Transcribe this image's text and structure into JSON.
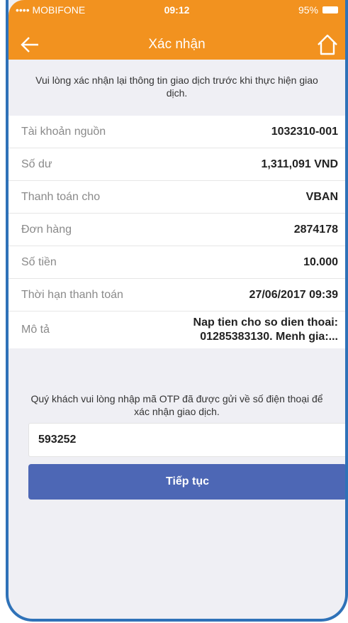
{
  "status_bar": {
    "carrier": "•••• MOBIFONE",
    "time": "09:12",
    "battery": "95%"
  },
  "header": {
    "title": "Xác nhận"
  },
  "intro_text": "Vui lòng xác nhận lại thông tin giao dịch trước khi thực hiện giao dịch.",
  "details": [
    {
      "label": "Tài khoản nguồn",
      "value": "1032310-001"
    },
    {
      "label": "Số dư",
      "value": "1,311,091 VND"
    },
    {
      "label": "Thanh toán cho",
      "value": "VBAN"
    },
    {
      "label": "Đơn hàng",
      "value": "2874178"
    },
    {
      "label": "Số tiền",
      "value": "10.000"
    },
    {
      "label": "Thời hạn thanh toán",
      "value": "27/06/2017 09:39"
    },
    {
      "label": "Mô tả",
      "value": "Nap tien cho so dien thoai:\n01285383130. Menh gia:..."
    }
  ],
  "otp_note": "Quý khách vui lòng nhập mã OTP đã được gửi về số điện thoại để xác nhận giao dịch.",
  "otp_value": "593252",
  "submit_label": "Tiếp tục",
  "colors": {
    "header": "#f2921f",
    "button": "#4d67b5",
    "frame": "#2f72b8",
    "background": "#efeff4"
  }
}
